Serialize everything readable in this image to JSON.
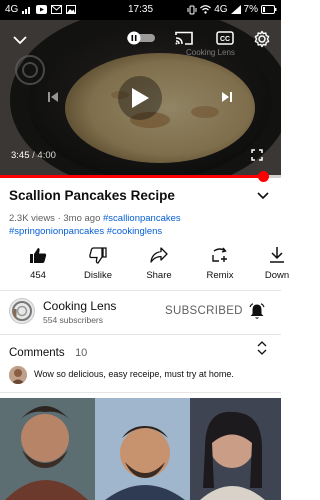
{
  "status_bar": {
    "network": "4G",
    "clock": "17:35",
    "network_right": "4G",
    "battery": "7%"
  },
  "player": {
    "current_time": "3:45",
    "separator": " / ",
    "total_time": "4:00",
    "progress_fraction": 0.9375,
    "watermark": "Cooking Lens"
  },
  "video": {
    "title": "Scallion Pancakes Recipe",
    "views": "2.3K views",
    "age": "3mo ago",
    "hashtags": [
      "#scallionpancakes",
      "#springonionpancakes",
      "#cookinglens"
    ]
  },
  "actions": [
    {
      "icon": "like-icon",
      "label": "454"
    },
    {
      "icon": "dislike-icon",
      "label": "Dislike"
    },
    {
      "icon": "share-icon",
      "label": "Share"
    },
    {
      "icon": "remix-icon",
      "label": "Remix"
    },
    {
      "icon": "download-icon",
      "label": "Down"
    }
  ],
  "channel": {
    "name": "Cooking Lens",
    "subscribers": "554 subscribers",
    "subscribe_state": "SUBSCRIBED"
  },
  "comments": {
    "title": "Comments",
    "count": "10",
    "top_comment": "Wow so delicious, easy receipe, must try at home."
  },
  "colors": {
    "accent": "#ff0000",
    "link": "#065fd4",
    "secondary_text": "#606060"
  }
}
